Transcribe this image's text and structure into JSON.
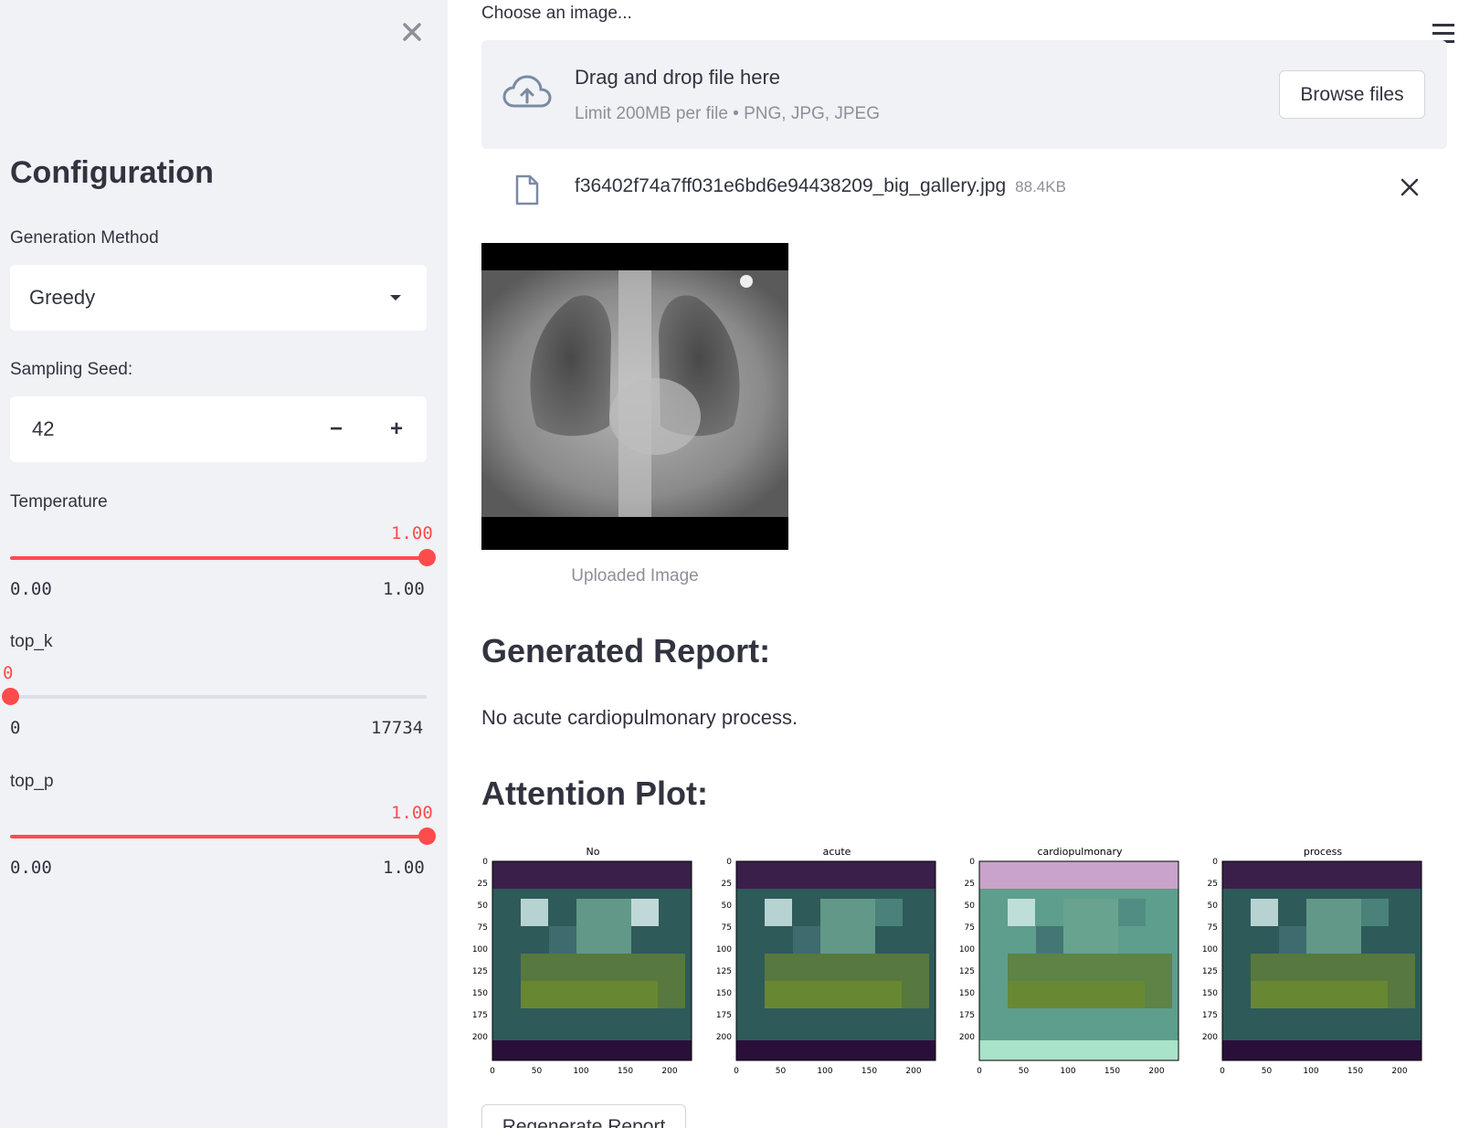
{
  "sidebar": {
    "title": "Configuration",
    "generation_method": {
      "label": "Generation Method",
      "value": "Greedy"
    },
    "sampling_seed": {
      "label": "Sampling Seed:",
      "value": "42",
      "minus": "−",
      "plus": "+"
    },
    "temperature": {
      "label": "Temperature",
      "value": "1.00",
      "min": "0.00",
      "max": "1.00",
      "fraction": 1.0
    },
    "top_k": {
      "label": "top_k",
      "value": "0",
      "min": "0",
      "max": "17734",
      "fraction": 0.0
    },
    "top_p": {
      "label": "top_p",
      "value": "1.00",
      "min": "0.00",
      "max": "1.00",
      "fraction": 1.0
    }
  },
  "uploader": {
    "label": "Choose an image...",
    "drop_text": "Drag and drop file here",
    "limit_text": "Limit 200MB per file • PNG, JPG, JPEG",
    "browse_label": "Browse files",
    "file_name": "f36402f74a7ff031e6bd6e94438209_big_gallery.jpg",
    "file_size": "88.4KB"
  },
  "image_caption": "Uploaded Image",
  "report": {
    "heading": "Generated Report:",
    "text": "No acute cardiopulmonary process."
  },
  "attention": {
    "heading": "Attention Plot:",
    "x_ticks": [
      "0",
      "50",
      "100",
      "150",
      "200"
    ],
    "y_ticks": [
      "0",
      "25",
      "50",
      "75",
      "100",
      "125",
      "150",
      "175",
      "200"
    ],
    "plots": [
      {
        "title": "No"
      },
      {
        "title": "acute"
      },
      {
        "title": "cardiopulmonary"
      },
      {
        "title": "process"
      }
    ]
  },
  "regenerate_label": "Regenerate Report",
  "icons": {
    "sidebar_close": "close-icon",
    "menu": "hamburger-menu-icon",
    "upload": "cloud-upload-icon",
    "file": "file-icon",
    "remove_file": "close-icon"
  },
  "colors": {
    "accent": "#ff4b4b",
    "sidebar_bg": "#f0f2f6",
    "text": "#31333f",
    "muted": "#8e8f98"
  }
}
